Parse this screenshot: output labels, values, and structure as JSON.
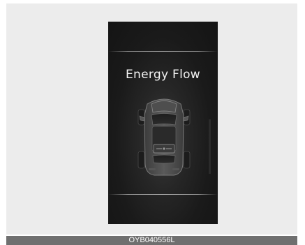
{
  "screen": {
    "title": "Energy Flow"
  },
  "caption": {
    "code": "OYB040556L"
  },
  "icons": {
    "vehicle": "car-top-view-icon"
  }
}
